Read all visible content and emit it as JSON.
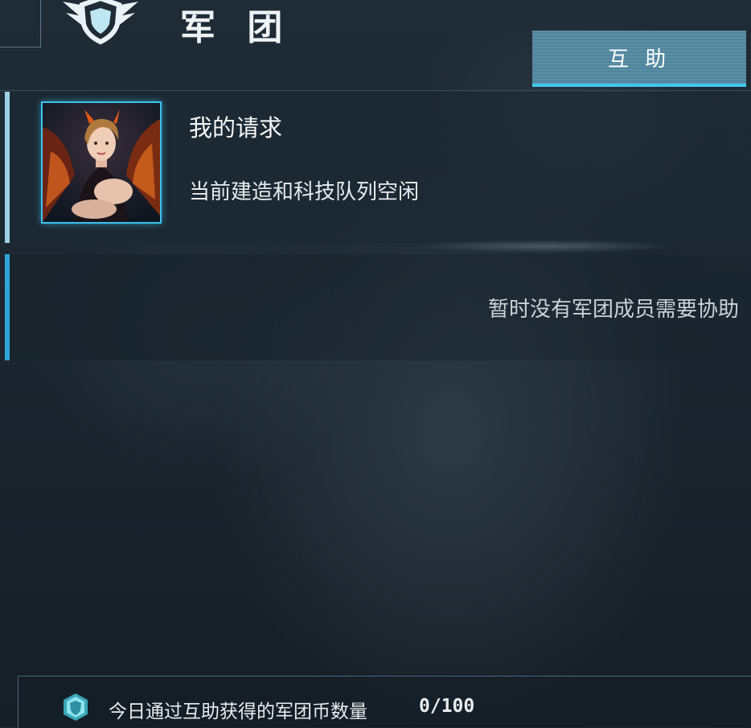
{
  "header": {
    "title": "军 团",
    "emblem_icon": "legion-shield-wings-icon"
  },
  "tabs": [
    {
      "label": "互 助",
      "active": true
    }
  ],
  "my_request": {
    "title": "我的请求",
    "status": "当前建造和科技队列空闲",
    "avatar_icon": "commander-portrait"
  },
  "members_help": {
    "empty_message": "暂时没有军团成员需要协助"
  },
  "footer": {
    "label": "今日通过互助获得的军团币数量",
    "count": "0/100",
    "coin_icon": "legion-coin-icon"
  },
  "colors": {
    "accent": "#3fc9ee",
    "tab_bg": "#5a8fa6",
    "background": "#1b2630"
  }
}
